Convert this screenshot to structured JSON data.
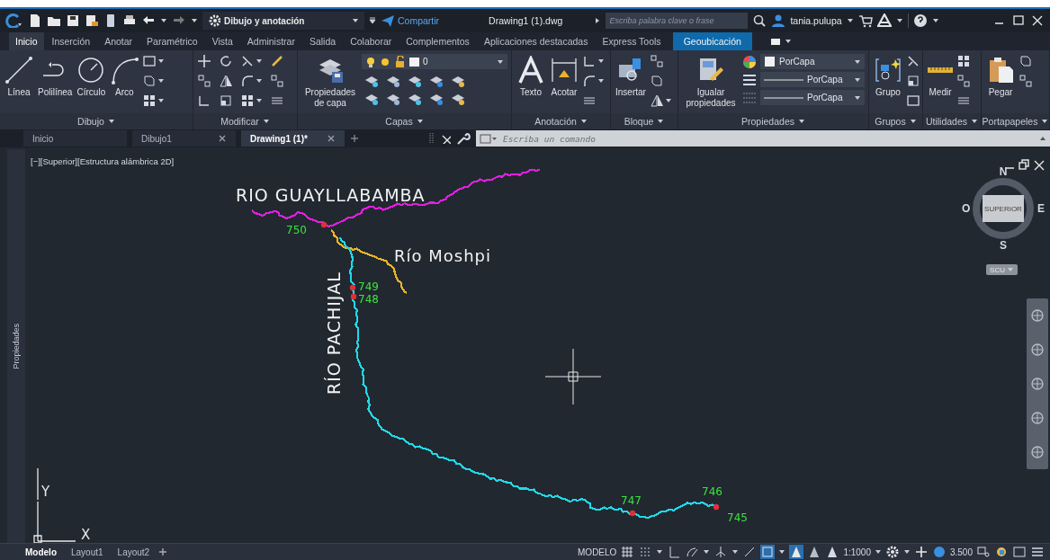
{
  "title_bar": {
    "workspace": "Dibujo y anotación",
    "share": "Compartir",
    "file": "Drawing1 (1).dwg",
    "search": {
      "placeholder": "Escriba palabra clave o frase"
    },
    "user": "tania.pulupa"
  },
  "ribbon_tabs": [
    {
      "label": "Inicio",
      "selected": true,
      "kind": "standard"
    },
    {
      "label": "Inserción",
      "selected": false,
      "kind": "standard"
    },
    {
      "label": "Anotar",
      "selected": false,
      "kind": "standard"
    },
    {
      "label": "Paramétrico",
      "selected": false,
      "kind": "standard"
    },
    {
      "label": "Vista",
      "selected": false,
      "kind": "standard"
    },
    {
      "label": "Administrar",
      "selected": false,
      "kind": "standard"
    },
    {
      "label": "Salida",
      "selected": false,
      "kind": "standard"
    },
    {
      "label": "Colaborar",
      "selected": false,
      "kind": "standard"
    },
    {
      "label": "Complementos",
      "selected": false,
      "kind": "standard"
    },
    {
      "label": "Aplicaciones destacadas",
      "selected": false,
      "kind": "standard"
    },
    {
      "label": "Express Tools",
      "selected": false,
      "kind": "standard"
    },
    {
      "label": "Geoubicación",
      "selected": false,
      "kind": "contextual"
    }
  ],
  "ribbon_panels": [
    {
      "title": "Dibujo",
      "tools": [
        "Línea",
        "Polilínea",
        "Círculo",
        "Arco"
      ]
    },
    {
      "title": "Modificar"
    },
    {
      "title": "Capas",
      "tools": [
        "Propiedades de capa"
      ],
      "layer": "0"
    },
    {
      "title": "Anotación",
      "tools": [
        "Texto",
        "Acotar"
      ]
    },
    {
      "title": "Bloque",
      "tools": [
        "Insertar"
      ]
    },
    {
      "title": "Propiedades",
      "tools": [
        "Igualar propiedades"
      ],
      "dropdowns": [
        "PorCapa",
        "PorCapa",
        "PorCapa"
      ]
    },
    {
      "title": "Grupos",
      "tools": [
        "Grupo"
      ]
    },
    {
      "title": "Utilidades",
      "tools": [
        "Medir"
      ]
    },
    {
      "title": "Portapapeles",
      "tools": [
        "Pegar"
      ]
    }
  ],
  "doc_tabs": [
    {
      "label": "Inicio",
      "selected": false,
      "closable": false
    },
    {
      "label": "Dibujo1",
      "selected": false,
      "closable": true
    },
    {
      "label": "Drawing1 (1)*",
      "selected": true,
      "closable": true
    }
  ],
  "command_line": {
    "placeholder": "Escriba un comando"
  },
  "viewport": {
    "label": "[−][Superior][Estructura alámbrica 2D]",
    "side_panel": "Propiedades",
    "rivers": [
      {
        "label": "RIO GUAYLLABAMBA",
        "color": "#e21ee0"
      },
      {
        "label": "Río Moshpi",
        "color": "#e8b52c"
      },
      {
        "label": "RÍO PACHIJAL",
        "color": "#21d9e6"
      }
    ],
    "points": [
      {
        "label": "750"
      },
      {
        "label": "749"
      },
      {
        "label": "748"
      },
      {
        "label": "747"
      },
      {
        "label": "746"
      },
      {
        "label": "745"
      }
    ],
    "compass": {
      "north": "N",
      "south": "S",
      "east": "E",
      "west": "O",
      "cube": "SUPERIOR"
    },
    "ucs": "SCU",
    "axes": {
      "x": "X",
      "y": "Y"
    }
  },
  "layout_tabs": [
    {
      "label": "Modelo",
      "selected": true
    },
    {
      "label": "Layout1",
      "selected": false
    },
    {
      "label": "Layout2",
      "selected": false
    }
  ],
  "status_bar": {
    "mode": "MODELO",
    "scale": "1:1000",
    "value": "3.500"
  }
}
